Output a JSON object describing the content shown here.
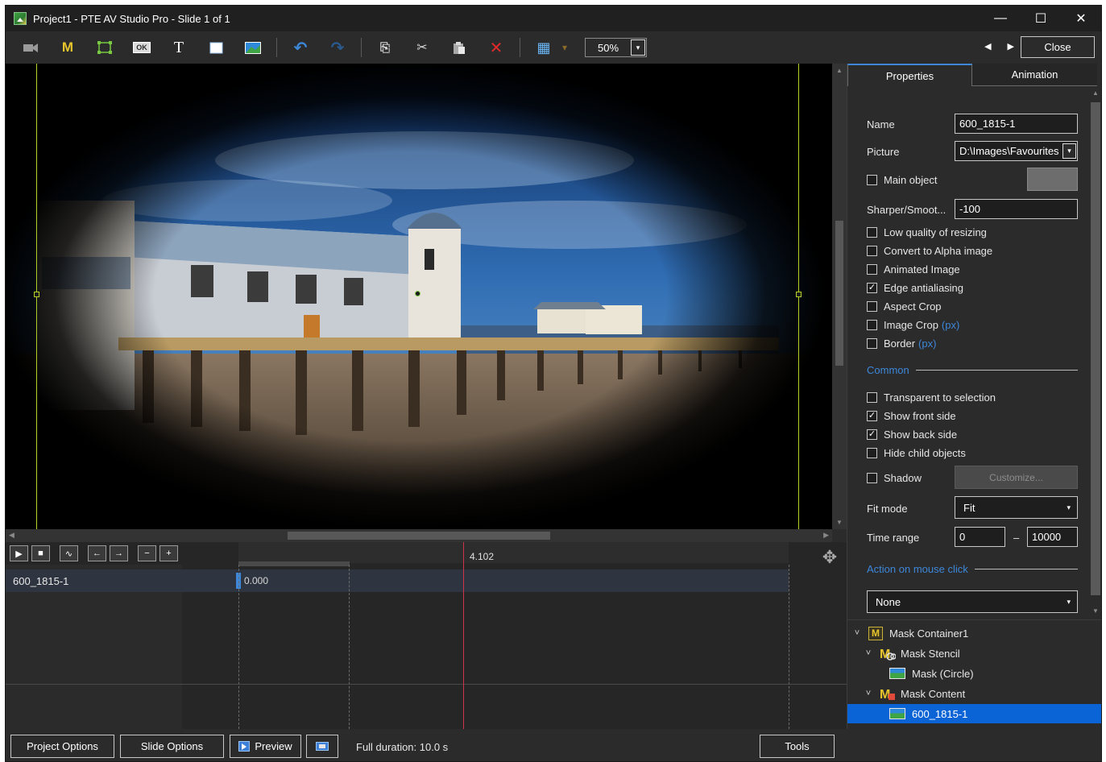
{
  "window": {
    "title": "Project1 - PTE AV Studio Pro - Slide 1 of 1",
    "controls": {
      "minimize": "—",
      "maximize": "☐",
      "close": "✕"
    }
  },
  "toolbar": {
    "tools": [
      {
        "name": "camera-icon",
        "glyph": "🎥"
      },
      {
        "name": "mask-container-icon",
        "glyph": "M"
      },
      {
        "name": "frame-icon",
        "glyph": "⬚"
      },
      {
        "name": "button-icon",
        "glyph": "OK"
      },
      {
        "name": "text-icon",
        "glyph": "T"
      },
      {
        "name": "rectangle-icon",
        "glyph": "◻"
      },
      {
        "name": "image-icon",
        "glyph": "▣"
      }
    ],
    "undo_glyph": "↶",
    "redo_glyph": "↷",
    "copy_glyph": "⎘",
    "cut_glyph": "✂",
    "paste_glyph": "📋",
    "delete_glyph": "✕",
    "grid_glyph": "▦",
    "dropdown_glyph": "▾",
    "zoom_value": "50%",
    "nav_prev": "◀",
    "nav_next": "▶",
    "close_label": "Close"
  },
  "timeline": {
    "buttons": [
      "▶",
      "■",
      "∿",
      "←",
      "→",
      "−",
      "+"
    ],
    "playhead_time": "4.102",
    "track_name": "600_1815-1",
    "track_start_value": "0.000",
    "move_glyph": "✥"
  },
  "bottom": {
    "project_options": "Project Options",
    "slide_options": "Slide Options",
    "preview": "Preview",
    "full_duration": "Full duration: 10.0 s",
    "tools": "Tools"
  },
  "panel": {
    "tabs": {
      "properties": "Properties",
      "animation": "Animation"
    },
    "name_label": "Name",
    "name_value": "600_1815-1",
    "picture_label": "Picture",
    "picture_value": "D:\\Images\\Favourites",
    "main_object": "Main object",
    "sharper_label": "Sharper/Smoot...",
    "sharper_value": "-100",
    "options": [
      {
        "label": "Low quality of resizing",
        "checked": false,
        "px": ""
      },
      {
        "label": "Convert to Alpha image",
        "checked": false,
        "px": ""
      },
      {
        "label": "Animated Image",
        "checked": false,
        "px": ""
      },
      {
        "label": "Edge antialiasing",
        "checked": true,
        "px": ""
      },
      {
        "label": "Aspect Crop",
        "checked": false,
        "px": ""
      },
      {
        "label": "Image Crop",
        "checked": false,
        "px": "(px)"
      },
      {
        "label": "Border",
        "checked": false,
        "px": "(px)"
      }
    ],
    "common_label": "Common",
    "common_options": [
      {
        "label": "Transparent to selection",
        "checked": false
      },
      {
        "label": "Show front side",
        "checked": true
      },
      {
        "label": "Show back side",
        "checked": true
      },
      {
        "label": "Hide child objects",
        "checked": false
      }
    ],
    "shadow_label": "Shadow",
    "customize_label": "Customize...",
    "fit_mode_label": "Fit mode",
    "fit_mode_value": "Fit",
    "time_range_label": "Time range",
    "time_range_from": "0",
    "time_range_dash": "–",
    "time_range_to": "10000",
    "action_label": "Action on mouse click",
    "action_value": "None",
    "check_glyph": "✓",
    "caret_glyph": "▾"
  },
  "tree": {
    "items": [
      {
        "label": "Mask Container1",
        "chevron": "˅"
      },
      {
        "label": "Mask Stencil",
        "chevron": "˅"
      },
      {
        "label": "Mask (Circle)",
        "chevron": ""
      },
      {
        "label": "Mask Content",
        "chevron": "˅"
      },
      {
        "label": "600_1815-1",
        "chevron": ""
      }
    ]
  },
  "colors": {
    "accent": "#3d87d9",
    "selection": "#0a64d6",
    "guide": "#b8d227",
    "playhead": "#d0344a",
    "delete": "#e02a2a"
  }
}
